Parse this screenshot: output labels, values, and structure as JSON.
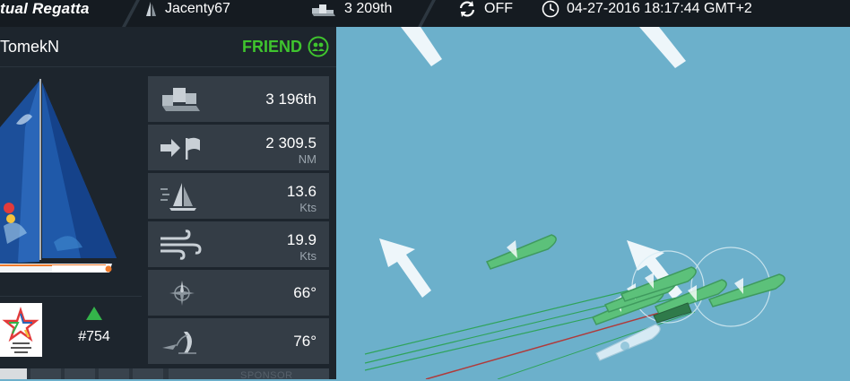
{
  "topbar": {
    "logo_text": "tual Regatta",
    "player_name": "Jacenty67",
    "player_rank": "3 209th",
    "sync_status": "OFF",
    "datetime": "04-27-2016 18:17:44 GMT+2"
  },
  "panel": {
    "name": "TomekN",
    "relation": "FRIEND",
    "rank": "#754",
    "sponsor_label": "SPONSOR"
  },
  "stats": {
    "ranking": {
      "value": "3 196th"
    },
    "distance": {
      "value": "2 309.5",
      "unit": "NM"
    },
    "boat_speed": {
      "value": "13.6",
      "unit": "Kts"
    },
    "wind_speed": {
      "value": "19.9",
      "unit": "Kts"
    },
    "heading": {
      "value": "66°"
    },
    "twa": {
      "value": "76°"
    }
  },
  "colors": {
    "map_water": "#6cb0cb",
    "panel_bg": "#1d252d",
    "friend_green": "#3fc42e",
    "boat_green": "#5cc17a",
    "track_red": "#c0392b"
  },
  "icons": [
    "boat-icon",
    "podium-icon",
    "sync-icon",
    "clock-icon",
    "friends-icon",
    "arrow-flag-icon",
    "sail-speed-icon",
    "wind-icon",
    "compass-icon",
    "sail-angle-icon",
    "rank-up-icon",
    "collapse-arrow-icon"
  ]
}
